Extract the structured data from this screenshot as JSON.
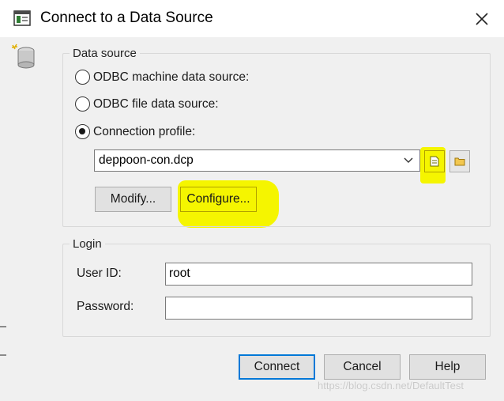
{
  "window": {
    "title": "Connect to a Data Source"
  },
  "icons": {
    "app": "database-window-icon",
    "close": "close-icon",
    "data_source": "database-cylinder-icon",
    "combo_arrow": "chevron-down-icon",
    "new_profile": "new-file-icon",
    "open_profile": "folder-icon"
  },
  "data_source": {
    "legend": "Data source",
    "options": [
      {
        "label": "ODBC machine data source:",
        "checked": false
      },
      {
        "label": "ODBC file data source:",
        "checked": false
      },
      {
        "label": "Connection profile:",
        "checked": true
      }
    ],
    "profile_value": "deppoon-con.dcp",
    "modify_label": "Modify...",
    "configure_label": "Configure..."
  },
  "login": {
    "legend": "Login",
    "user_id_label": "User ID:",
    "user_id_value": "root",
    "password_label": "Password:",
    "password_value": ""
  },
  "buttons": {
    "connect": "Connect",
    "cancel": "Cancel",
    "help": "Help"
  },
  "watermark": "https://blog.csdn.net/DefaultTest",
  "colors": {
    "highlight": "#f5f500",
    "default_button_border": "#0078d7",
    "window_bg": "#f0f0f0"
  }
}
